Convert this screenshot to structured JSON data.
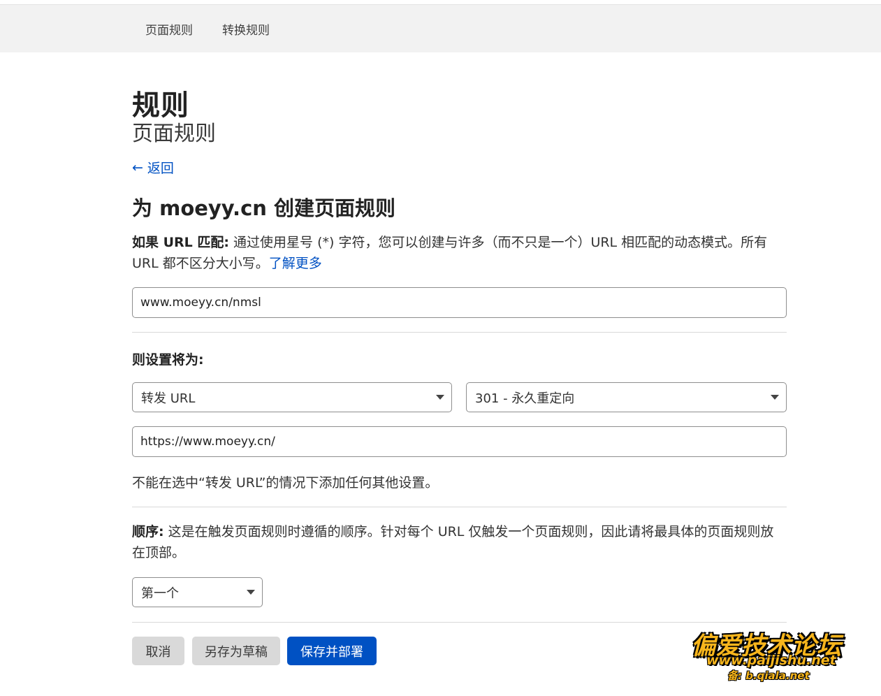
{
  "tabs": [
    {
      "label": "页面规则"
    },
    {
      "label": "转换规则"
    }
  ],
  "header": {
    "title": "规则",
    "subtitle": "页面规则"
  },
  "back": {
    "label": "返回"
  },
  "form": {
    "heading": "为 moeyy.cn 创建页面规则",
    "url_match": {
      "label": "如果 URL 匹配:",
      "description": " 通过使用星号 (*) 字符，您可以创建与许多（而不只是一个）URL 相匹配的动态模式。所有 URL 都不区分大小写。",
      "learn_more": "了解更多",
      "value": "www.moeyy.cn/nmsl"
    },
    "settings": {
      "label": "则设置将为:",
      "setting_select": "转发 URL",
      "status_select": "301 - 永久重定向",
      "destination_value": "https://www.moeyy.cn/",
      "note": "不能在选中“转发 URL”的情况下添加任何其他设置。"
    },
    "order": {
      "label": "顺序:",
      "description": " 这是在触发页面规则时遵循的顺序。针对每个 URL 仅触发一个页面规则，因此请将最具体的页面规则放在顶部。",
      "select": "第一个"
    },
    "buttons": {
      "cancel": "取消",
      "draft": "另存为草稿",
      "deploy": "保存并部署"
    }
  },
  "watermark": {
    "title": "偏爱技术论坛",
    "url": "www.paijishu.net",
    "sub": "备: b.qiala.net"
  },
  "colors": {
    "accent": "#0051c3",
    "tabbar_bg": "#f2f2f2",
    "secondary_button": "#d9d9d9",
    "watermark": "#f7b51c"
  }
}
